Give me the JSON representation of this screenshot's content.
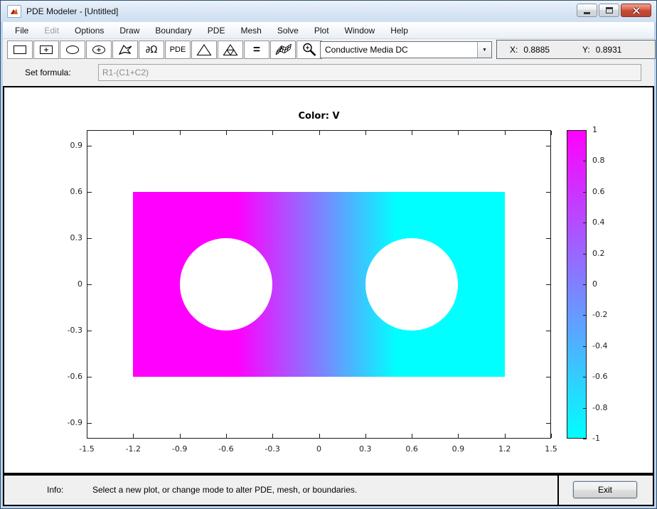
{
  "window": {
    "title": "PDE Modeler - [Untitled]"
  },
  "menu_bar": {
    "items": [
      {
        "label": "File",
        "enabled": true
      },
      {
        "label": "Edit",
        "enabled": false
      },
      {
        "label": "Options",
        "enabled": true
      },
      {
        "label": "Draw",
        "enabled": true
      },
      {
        "label": "Boundary",
        "enabled": true
      },
      {
        "label": "PDE",
        "enabled": true
      },
      {
        "label": "Mesh",
        "enabled": true
      },
      {
        "label": "Solve",
        "enabled": true
      },
      {
        "label": "Plot",
        "enabled": true
      },
      {
        "label": "Window",
        "enabled": true
      },
      {
        "label": "Help",
        "enabled": true
      }
    ]
  },
  "toolbar": {
    "buttons": [
      {
        "name": "draw-rectangle-icon"
      },
      {
        "name": "draw-centered-rectangle-icon"
      },
      {
        "name": "draw-ellipse-icon"
      },
      {
        "name": "draw-centered-ellipse-icon"
      },
      {
        "name": "draw-polygon-icon"
      },
      {
        "name": "boundary-mode-button",
        "text": "∂Ω"
      },
      {
        "name": "pde-mode-button",
        "text": "PDE"
      },
      {
        "name": "initialize-mesh-icon"
      },
      {
        "name": "refine-mesh-icon"
      },
      {
        "name": "solve-button",
        "text": "="
      },
      {
        "name": "plot-solution-icon"
      },
      {
        "name": "zoom-icon"
      }
    ],
    "application_mode": "Conductive Media DC",
    "coordinates": {
      "x_label": "X:",
      "x_value": "0.8885",
      "y_label": "Y:",
      "y_value": "0.8931"
    }
  },
  "formula_bar": {
    "label": "Set formula:",
    "value": "R1-(C1+C2)"
  },
  "plot": {
    "title": "Color: V",
    "axes": {
      "x_range": [
        -1.5,
        1.5
      ],
      "y_range": [
        -1,
        1
      ]
    },
    "x_ticks": [
      -1.5,
      -1.2,
      -0.9,
      -0.6,
      -0.3,
      0,
      0.3,
      0.6,
      0.9,
      1.2,
      1.5
    ],
    "y_ticks": [
      0.9,
      0.6,
      0.3,
      0,
      -0.3,
      -0.6,
      -0.9
    ],
    "colormap": {
      "high": "#ff00ff",
      "mid": "#8080ff",
      "low": "#00ffff"
    },
    "colorbar": {
      "range": [
        -1,
        1
      ],
      "ticks": [
        1,
        0.8,
        0.6,
        0.4,
        0.2,
        0,
        -0.2,
        -0.4,
        -0.6,
        -0.8,
        -1
      ]
    },
    "geometry": {
      "rectangle": {
        "x": [
          -1.2,
          1.2
        ],
        "y": [
          -0.6,
          0.6
        ]
      },
      "holes": [
        {
          "cx": -0.6,
          "cy": 0,
          "r": 0.3
        },
        {
          "cx": 0.6,
          "cy": 0,
          "r": 0.3
        }
      ]
    }
  },
  "status_bar": {
    "info_label": "Info:",
    "message": "Select a new plot, or change mode to alter PDE, mesh, or boundaries.",
    "exit_label": "Exit"
  }
}
